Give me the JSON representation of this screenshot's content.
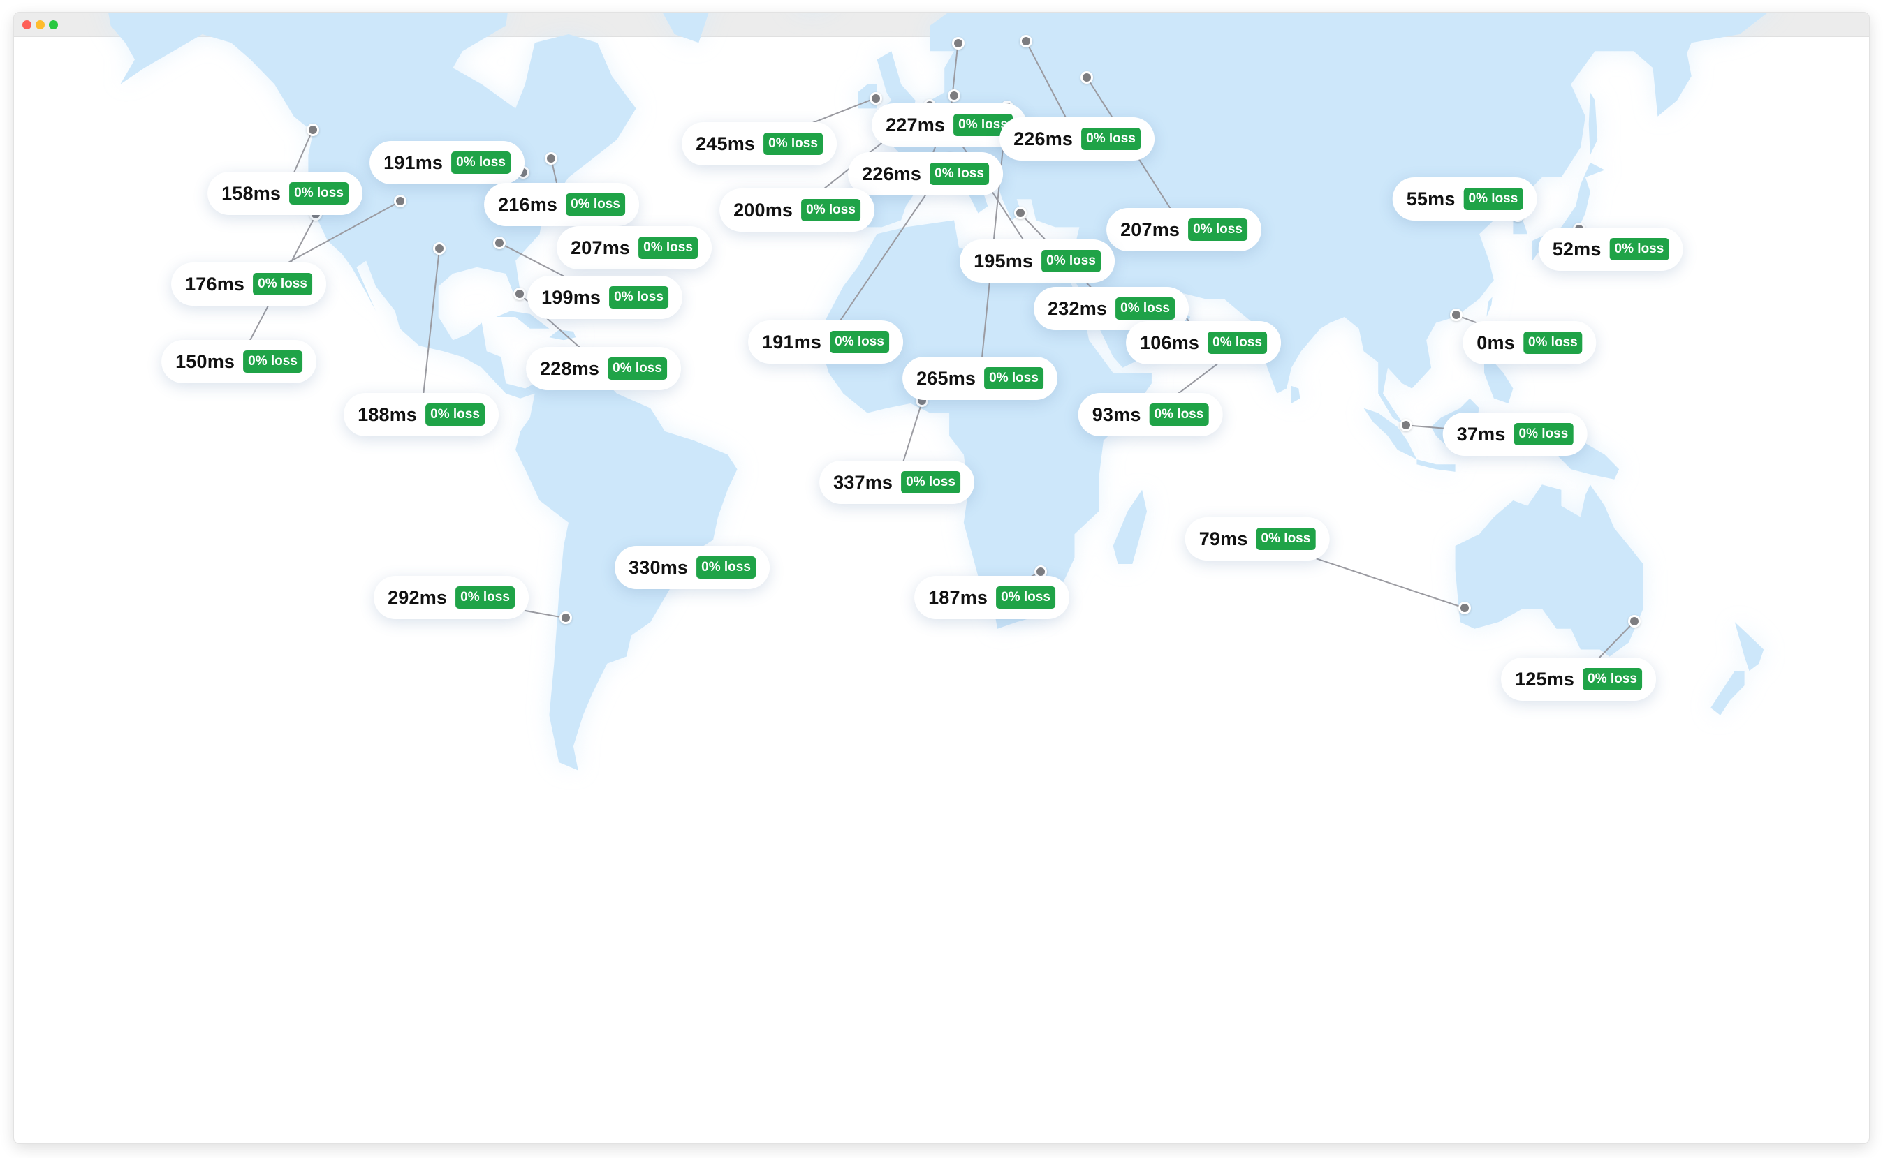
{
  "window": {
    "controls": [
      "close",
      "minimize",
      "maximize"
    ]
  },
  "map": {
    "land_color": "#cde7fa",
    "pin_color": "#7d7d80",
    "loss_color": "#1fa347",
    "locations": [
      {
        "latency": "191ms",
        "loss": "0% loss",
        "lon": -79.4,
        "lat": 43.7
      },
      {
        "latency": "158ms",
        "loss": "0% loss",
        "lon": -123.1,
        "lat": 49.3
      },
      {
        "latency": "216ms",
        "loss": "0% loss",
        "lon": -73.6,
        "lat": 45.5
      },
      {
        "latency": "207ms",
        "loss": "0% loss",
        "lon": -74.0,
        "lat": 40.7
      },
      {
        "latency": "176ms",
        "loss": "0% loss",
        "lon": -104.9,
        "lat": 39.7
      },
      {
        "latency": "150ms",
        "loss": "0% loss",
        "lon": -122.4,
        "lat": 37.8
      },
      {
        "latency": "199ms",
        "loss": "0% loss",
        "lon": -84.4,
        "lat": 33.7
      },
      {
        "latency": "188ms",
        "loss": "0% loss",
        "lon": -96.8,
        "lat": 32.8
      },
      {
        "latency": "228ms",
        "loss": "0% loss",
        "lon": -80.2,
        "lat": 25.8
      },
      {
        "latency": "245ms",
        "loss": "0% loss",
        "lon": -6.3,
        "lat": 53.3
      },
      {
        "latency": "227ms",
        "loss": "0% loss",
        "lon": 10.8,
        "lat": 59.9
      },
      {
        "latency": "226ms",
        "loss": "0% loss",
        "lon": 24.9,
        "lat": 60.2
      },
      {
        "latency": "226ms",
        "loss": "0% loss",
        "lon": 10.0,
        "lat": 53.6
      },
      {
        "latency": "200ms",
        "loss": "0% loss",
        "lon": 4.9,
        "lat": 52.4
      },
      {
        "latency": "207ms",
        "loss": "0% loss",
        "lon": 37.6,
        "lat": 55.8
      },
      {
        "latency": "195ms",
        "loss": "0% loss",
        "lon": 8.7,
        "lat": 50.1
      },
      {
        "latency": "191ms",
        "loss": "0% loss",
        "lon": 9.2,
        "lat": 45.5
      },
      {
        "latency": "232ms",
        "loss": "0% loss",
        "lon": 23.7,
        "lat": 38.0
      },
      {
        "latency": "265ms",
        "loss": "0% loss",
        "lon": 21.0,
        "lat": 52.2
      },
      {
        "latency": "106ms",
        "loss": "0% loss",
        "lon": 55.3,
        "lat": 25.2
      },
      {
        "latency": "93ms",
        "loss": "0% loss",
        "lon": 72.9,
        "lat": 19.1
      },
      {
        "latency": "337ms",
        "loss": "0% loss",
        "lon": 3.4,
        "lat": 6.5
      },
      {
        "latency": "187ms",
        "loss": "0% loss",
        "lon": 28.0,
        "lat": -26.2
      },
      {
        "latency": "330ms",
        "loss": "0% loss",
        "lon": -46.6,
        "lat": -23.5
      },
      {
        "latency": "292ms",
        "loss": "0% loss",
        "lon": -70.6,
        "lat": -33.4
      },
      {
        "latency": "55ms",
        "loss": "0% loss",
        "lon": 127.0,
        "lat": 37.6
      },
      {
        "latency": "52ms",
        "loss": "0% loss",
        "lon": 139.7,
        "lat": 35.7
      },
      {
        "latency": "0ms",
        "loss": "0% loss",
        "lon": 114.2,
        "lat": 22.3
      },
      {
        "latency": "37ms",
        "loss": "0% loss",
        "lon": 103.8,
        "lat": 1.35
      },
      {
        "latency": "79ms",
        "loss": "0% loss",
        "lon": 115.9,
        "lat": -31.9
      },
      {
        "latency": "125ms",
        "loss": "0% loss",
        "lon": 151.2,
        "lat": -33.9
      }
    ]
  }
}
